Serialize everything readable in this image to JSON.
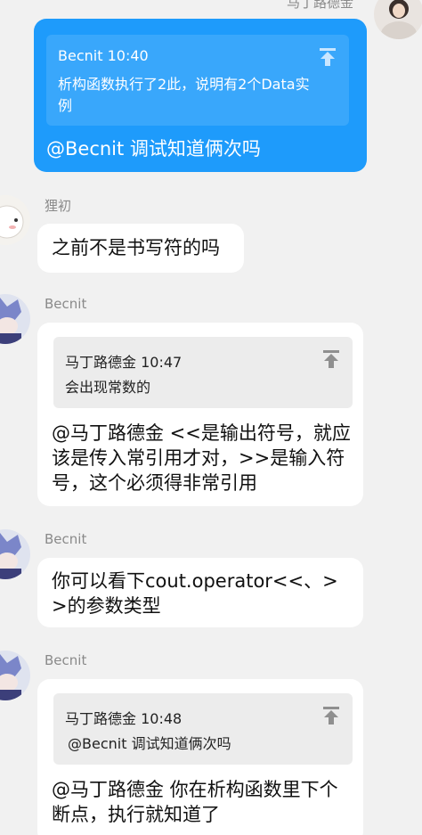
{
  "colors": {
    "background": "#f1f1f1",
    "own_bubble": "#1e9bfb",
    "other_bubble": "#ffffff",
    "quote_box": "#ececec",
    "name_text": "#8a8a8a"
  },
  "top_header": {
    "sender": "马丁路德金"
  },
  "messages": [
    {
      "side": "right",
      "quote": {
        "author": "Becnit",
        "time": "10:40",
        "text": "析构函数执行了2此，说明有2个Data实例"
      },
      "text": "@Becnit 调试知道俩次吗"
    },
    {
      "side": "left",
      "sender": "狸初",
      "text": "之前不是书写符的吗"
    },
    {
      "side": "left",
      "sender": "Becnit",
      "quote": {
        "author": "马丁路德金",
        "time": "10:47",
        "text": "会出现常数的"
      },
      "text": "@马丁路德金 <<是输出符号，就应该是传入常引用才对，>>是输入符号，这个必须得非常引用"
    },
    {
      "side": "left",
      "sender": "Becnit",
      "text": "你可以看下cout.operator<<、>>的参数类型"
    },
    {
      "side": "left",
      "sender": "Becnit",
      "quote": {
        "author": "马丁路德金",
        "time": "10:48",
        "text": "@Becnit 调试知道俩次吗"
      },
      "text": "@马丁路德金 你在析构函数里下个断点，执行就知道了"
    }
  ],
  "icons": {
    "quote_jump": "jump-to-original-icon",
    "avatar_self": "avatar-self",
    "avatar_lichu": "avatar-lichu",
    "avatar_becnit": "avatar-becnit"
  }
}
